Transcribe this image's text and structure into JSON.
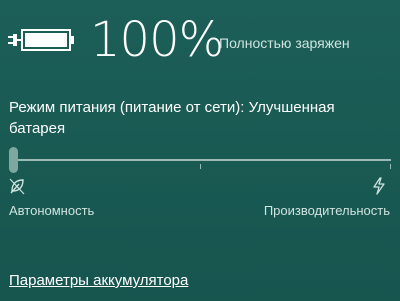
{
  "battery": {
    "percent_text": "100%",
    "status": "Полностью заряжен",
    "level_fraction": 1.0
  },
  "power_mode": {
    "label": "Режим питания (питание от сети): Улучшенная батарея",
    "slider_position_fraction": 0.0,
    "left_label": "Автономность",
    "right_label": "Производительность",
    "left_icon": "leaf-icon",
    "right_icon": "lightning-bolt-icon"
  },
  "link": {
    "text": "Параметры аккумулятора"
  },
  "colors": {
    "background": "#1c5f58",
    "text_primary": "#ffffff",
    "text_secondary": "#cfe3df",
    "slider_track": "#9cb9b5",
    "slider_thumb": "#7fa79f"
  }
}
